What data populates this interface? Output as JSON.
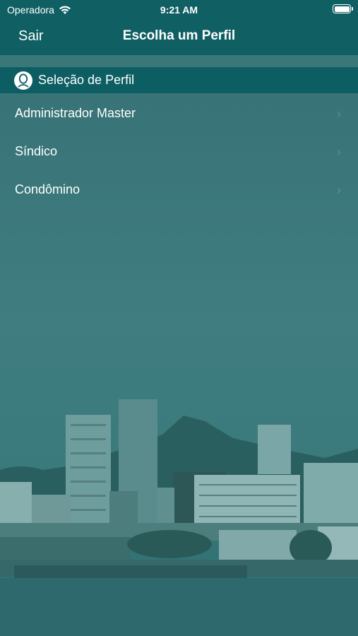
{
  "status_bar": {
    "carrier": "Operadora",
    "time": "9:21 AM"
  },
  "nav": {
    "back_label": "Sair",
    "title": "Escolha um Perfil"
  },
  "section": {
    "label": "Seleção de Perfil",
    "icon": "person-icon"
  },
  "profiles": [
    {
      "label": "Administrador Master"
    },
    {
      "label": "Síndico"
    },
    {
      "label": "Condômino"
    }
  ],
  "colors": {
    "accent": "#0d5e63",
    "background": "#3d7c7f",
    "navbar": "#0f5f63"
  }
}
